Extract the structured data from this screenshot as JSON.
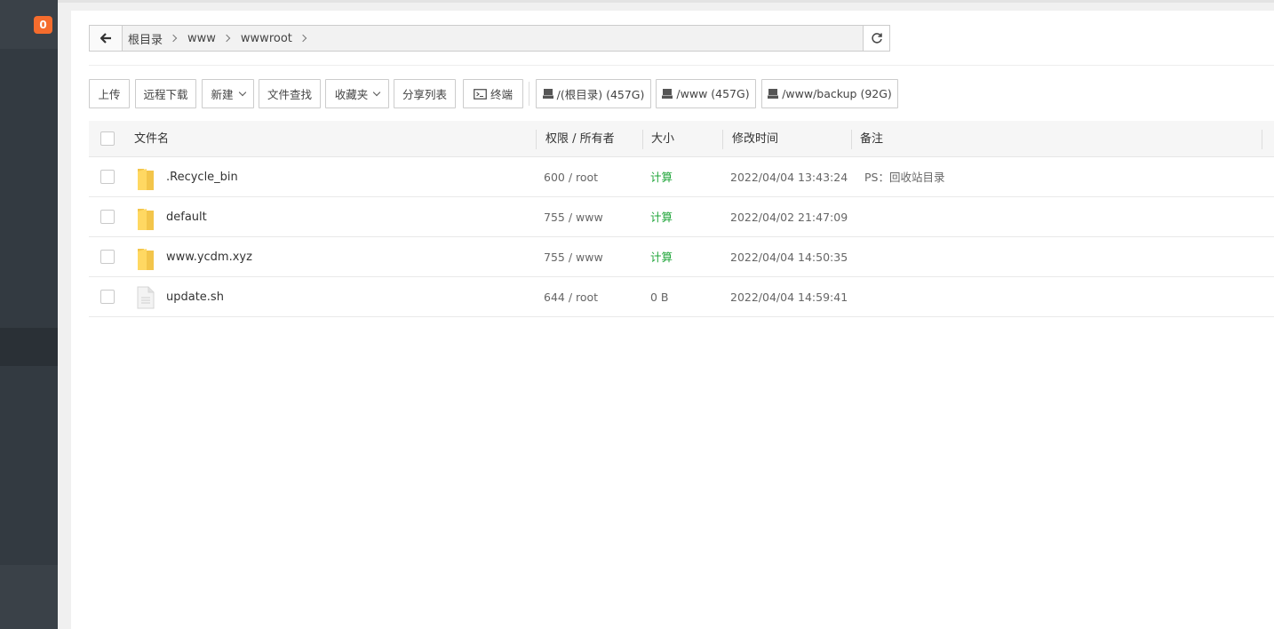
{
  "sidebar": {
    "badge_count": "0"
  },
  "pathbar": {
    "crumbs": [
      "根目录",
      "www",
      "wwwroot"
    ]
  },
  "toolbar": {
    "upload": "上传",
    "remote_download": "远程下载",
    "new": "新建",
    "file_search": "文件查找",
    "favorites": "收藏夹",
    "share_list": "分享列表",
    "terminal": "终端",
    "disks": [
      {
        "label": "/(根目录) (457G)"
      },
      {
        "label": "/www (457G)"
      },
      {
        "label": "/www/backup (92G)"
      }
    ]
  },
  "table": {
    "headers": {
      "name": "文件名",
      "perm": "权限 / 所有者",
      "size": "大小",
      "mtime": "修改时间",
      "note": "备注"
    },
    "rows": [
      {
        "type": "folder",
        "name": ".Recycle_bin",
        "perm": "600 / root",
        "size": "计算",
        "mtime": "2022/04/04 13:43:24",
        "note": "PS：回收站目录"
      },
      {
        "type": "folder",
        "name": "default",
        "perm": "755 / www",
        "size": "计算",
        "mtime": "2022/04/02 21:47:09",
        "note": ""
      },
      {
        "type": "folder",
        "name": "www.ycdm.xyz",
        "perm": "755 / www",
        "size": "计算",
        "mtime": "2022/04/04 14:50:35",
        "note": ""
      },
      {
        "type": "file",
        "name": "update.sh",
        "perm": "644 / root",
        "size": "0 B",
        "mtime": "2022/04/04 14:59:41",
        "note": ""
      }
    ]
  },
  "colors": {
    "accent_green": "#20a53a",
    "badge_orange": "#f56c2d",
    "sidebar": "#333a41"
  }
}
